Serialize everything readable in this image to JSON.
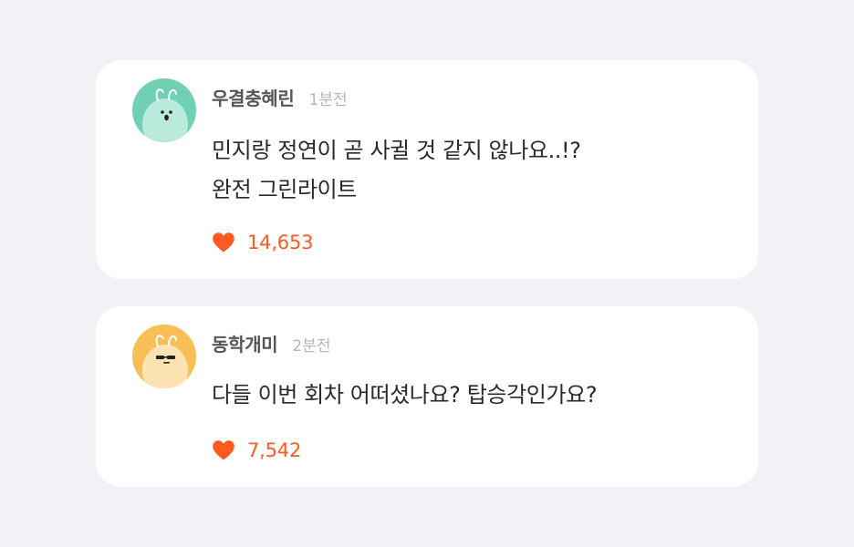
{
  "colors": {
    "background": "#f2f2f6",
    "card": "#ffffff",
    "like_accent": "#ff5a1f",
    "avatar_1": "#6fd0b4",
    "avatar_2": "#f8bf57"
  },
  "comments": [
    {
      "username": "우결충혜린",
      "time": "1분전",
      "lines": [
        "민지랑 정연이 곧 사귈 것 같지 않나요..!?",
        "완전 그린라이트"
      ],
      "likes": "14,653",
      "avatar_icon": "mint-bug-avatar-icon",
      "like_icon": "heart-icon"
    },
    {
      "username": "동학개미",
      "time": "2분전",
      "lines": [
        "다들 이번 회차 어떠셨나요? 탑승각인가요?"
      ],
      "likes": "7,542",
      "avatar_icon": "yellow-bug-sunglasses-avatar-icon",
      "like_icon": "heart-icon"
    }
  ]
}
